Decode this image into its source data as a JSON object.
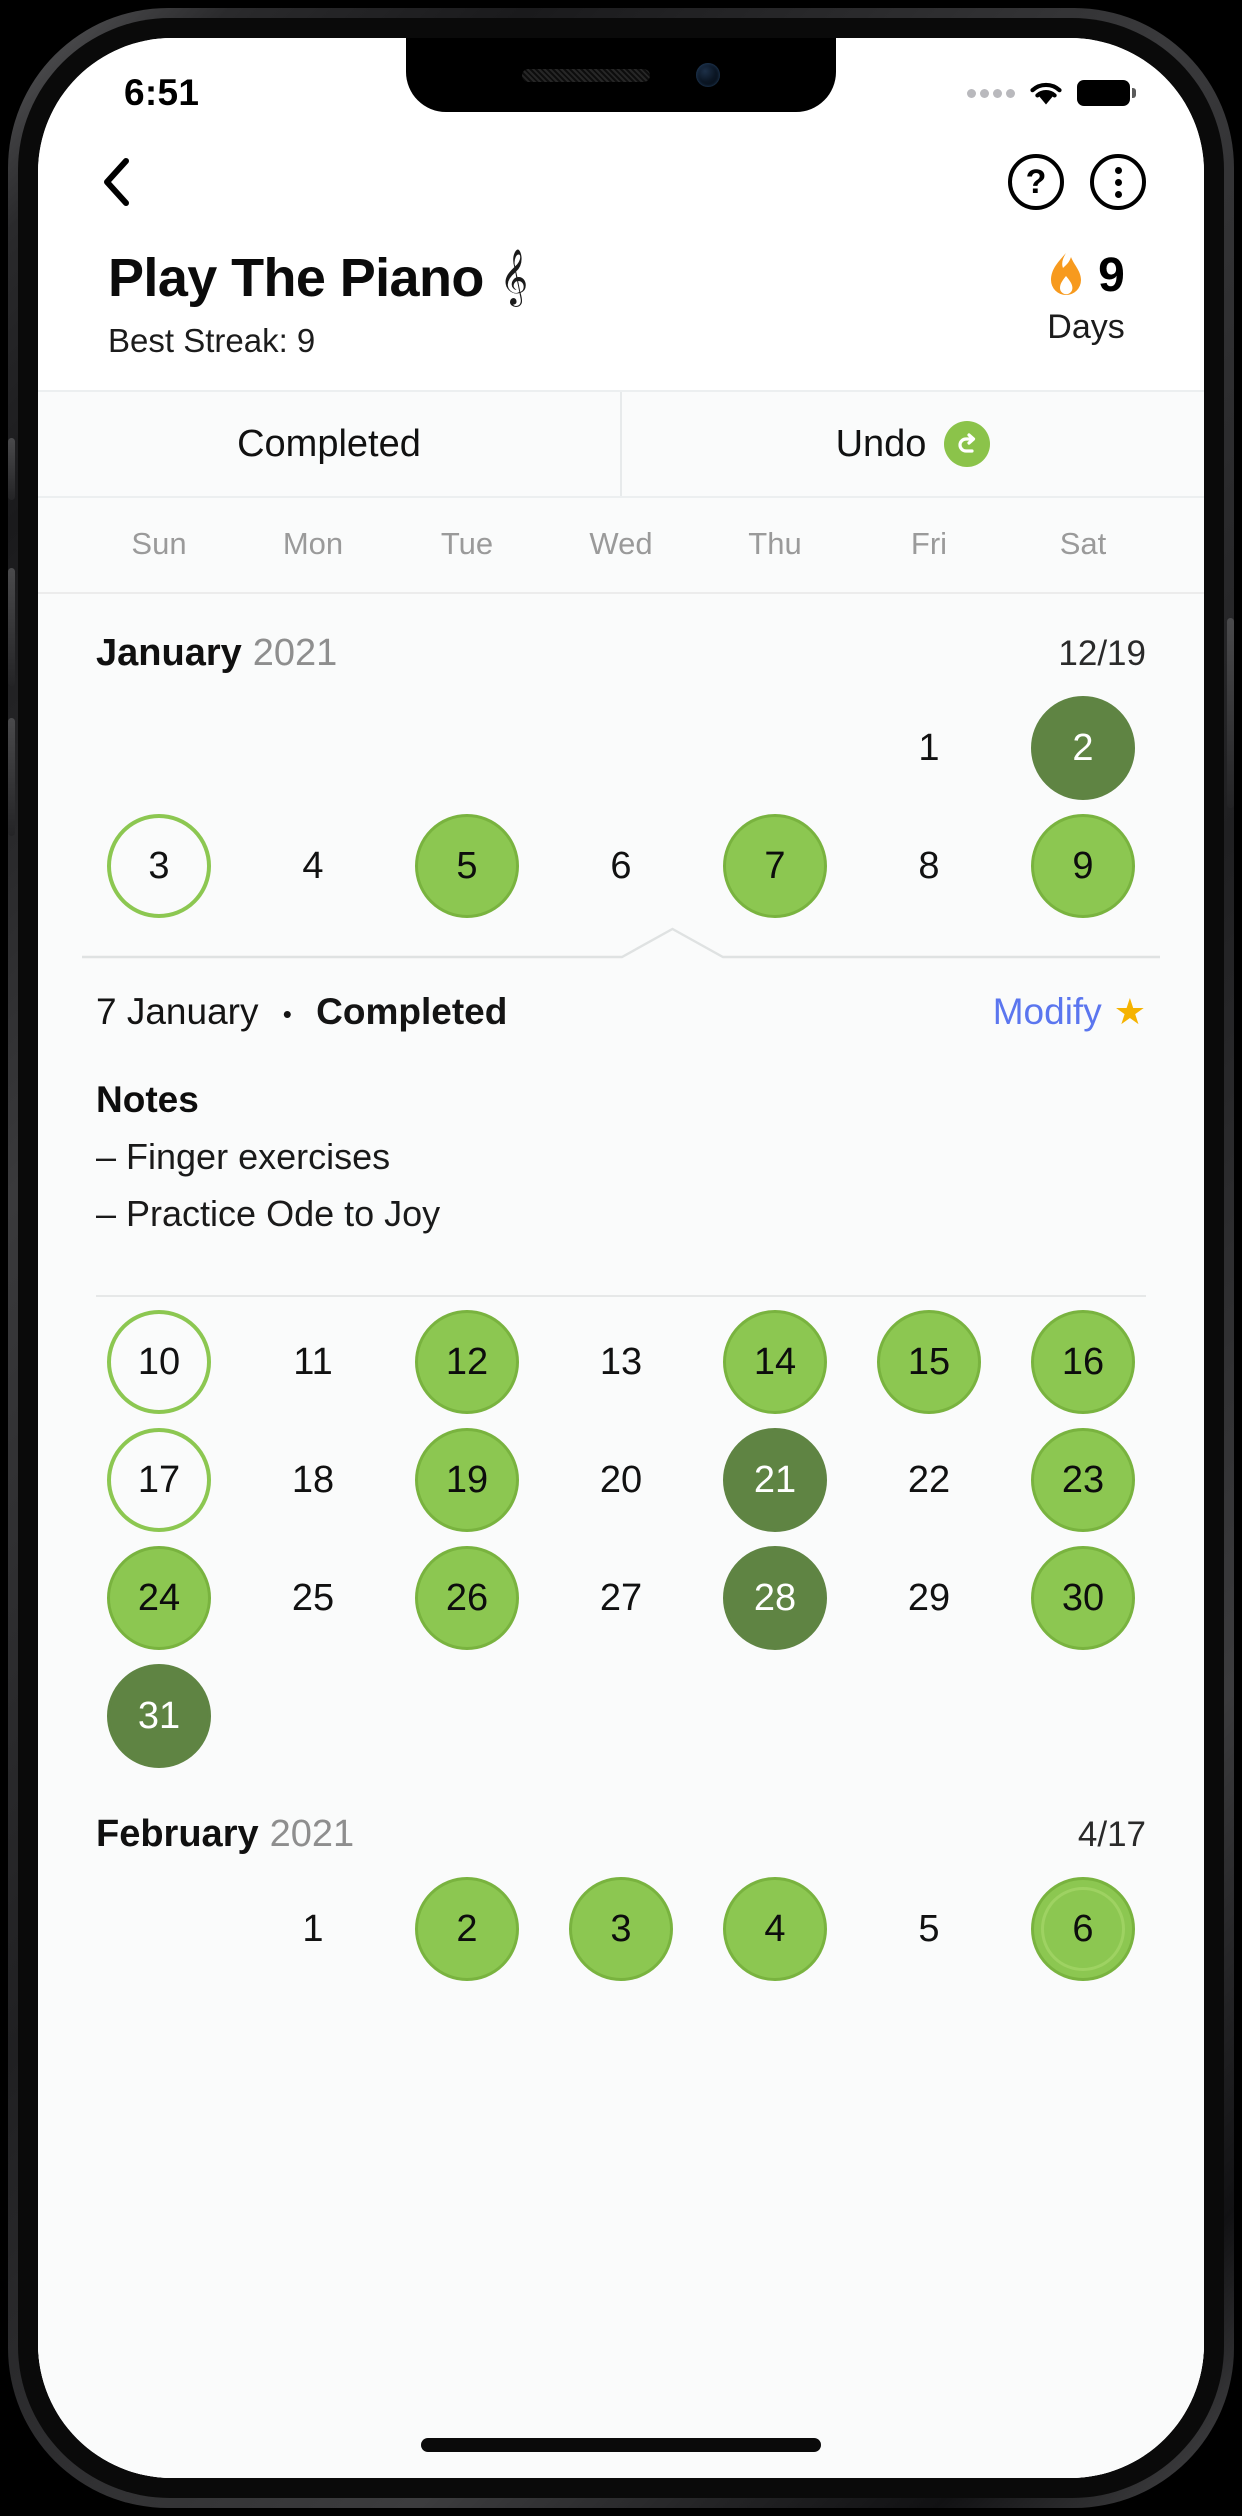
{
  "status_bar": {
    "time": "6:51",
    "wifi_icon": "wifi-icon",
    "battery_icon": "battery-full-icon",
    "signal_icon": "signal-dots-icon"
  },
  "nav": {
    "back_icon": "back-chevron-icon",
    "help_icon": "help-circle-icon",
    "help_label": "?",
    "menu_icon": "more-vertical-circle-icon"
  },
  "header": {
    "title": "Play The Piano",
    "title_emoji": "𝄞",
    "title_emoji_name": "musical-staff-icon",
    "best_streak": "Best Streak: 9",
    "streak_icon": "flame-icon",
    "streak_count": "9",
    "streak_unit": "Days"
  },
  "tabs": [
    {
      "label": "Completed",
      "icon": null
    },
    {
      "label": "Undo",
      "icon": "undo-arrow-icon"
    }
  ],
  "weekdays": [
    "Sun",
    "Mon",
    "Tue",
    "Wed",
    "Thu",
    "Fri",
    "Sat"
  ],
  "months": [
    {
      "name": "January",
      "year": "2021",
      "count": "12/19",
      "weeks": [
        [
          {
            "label": "",
            "state": "empty"
          },
          {
            "label": "",
            "state": "empty"
          },
          {
            "label": "",
            "state": "empty"
          },
          {
            "label": "",
            "state": "empty"
          },
          {
            "label": "",
            "state": "empty"
          },
          {
            "label": "1",
            "state": "plain"
          },
          {
            "label": "2",
            "state": "done-dark"
          }
        ],
        [
          {
            "label": "3",
            "state": "outline"
          },
          {
            "label": "4",
            "state": "plain"
          },
          {
            "label": "5",
            "state": "done"
          },
          {
            "label": "6",
            "state": "plain"
          },
          {
            "label": "7",
            "state": "done"
          },
          {
            "label": "8",
            "state": "plain"
          },
          {
            "label": "9",
            "state": "done"
          }
        ],
        [
          {
            "label": "10",
            "state": "outline"
          },
          {
            "label": "11",
            "state": "plain"
          },
          {
            "label": "12",
            "state": "done"
          },
          {
            "label": "13",
            "state": "plain"
          },
          {
            "label": "14",
            "state": "done"
          },
          {
            "label": "15",
            "state": "done"
          },
          {
            "label": "16",
            "state": "done"
          }
        ],
        [
          {
            "label": "17",
            "state": "outline"
          },
          {
            "label": "18",
            "state": "plain"
          },
          {
            "label": "19",
            "state": "done"
          },
          {
            "label": "20",
            "state": "plain"
          },
          {
            "label": "21",
            "state": "done-dark"
          },
          {
            "label": "22",
            "state": "plain"
          },
          {
            "label": "23",
            "state": "done"
          }
        ],
        [
          {
            "label": "24",
            "state": "done"
          },
          {
            "label": "25",
            "state": "plain"
          },
          {
            "label": "26",
            "state": "done"
          },
          {
            "label": "27",
            "state": "plain"
          },
          {
            "label": "28",
            "state": "done-dark"
          },
          {
            "label": "29",
            "state": "plain"
          },
          {
            "label": "30",
            "state": "done"
          }
        ],
        [
          {
            "label": "31",
            "state": "done-dark"
          },
          {
            "label": "",
            "state": "empty"
          },
          {
            "label": "",
            "state": "empty"
          },
          {
            "label": "",
            "state": "empty"
          },
          {
            "label": "",
            "state": "empty"
          },
          {
            "label": "",
            "state": "empty"
          },
          {
            "label": "",
            "state": "empty"
          }
        ]
      ]
    },
    {
      "name": "February",
      "year": "2021",
      "count": "4/17",
      "weeks": [
        [
          {
            "label": "",
            "state": "empty"
          },
          {
            "label": "1",
            "state": "plain"
          },
          {
            "label": "2",
            "state": "done"
          },
          {
            "label": "3",
            "state": "done"
          },
          {
            "label": "4",
            "state": "done"
          },
          {
            "label": "5",
            "state": "plain"
          },
          {
            "label": "6",
            "state": "done today"
          }
        ]
      ]
    }
  ],
  "detail": {
    "date": "7 January",
    "separator": "•",
    "status": "Completed",
    "modify_label": "Modify",
    "star_icon": "star-icon",
    "star_glyph": "★",
    "notes_label": "Notes",
    "notes": [
      "– Finger exercises",
      "– Practice Ode to Joy"
    ]
  },
  "colors": {
    "done_fill": "#8cc751",
    "done_border": "#79b33f",
    "done_dark_fill": "#5f8443",
    "outline_border": "#8cc751",
    "flame": "#f79a1e",
    "modify_link": "#5b76ef",
    "star": "#f5b301",
    "undo_badge": "#8bc34a"
  }
}
